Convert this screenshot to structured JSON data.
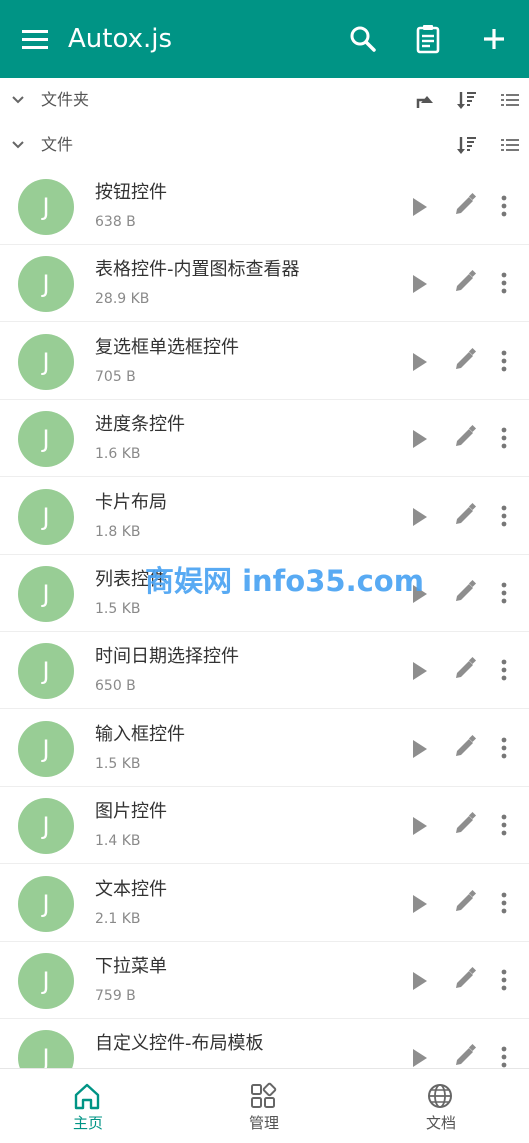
{
  "app": {
    "title": "Autox.js"
  },
  "sections": {
    "folders_label": "文件夹",
    "files_label": "文件"
  },
  "files": [
    {
      "name": "按钮控件",
      "size": "638 B"
    },
    {
      "name": "表格控件-内置图标查看器",
      "size": "28.9 KB"
    },
    {
      "name": "复选框单选框控件",
      "size": "705 B"
    },
    {
      "name": "进度条控件",
      "size": "1.6 KB"
    },
    {
      "name": "卡片布局",
      "size": "1.8 KB"
    },
    {
      "name": "列表控件",
      "size": "1.5 KB"
    },
    {
      "name": "时间日期选择控件",
      "size": "650 B"
    },
    {
      "name": "输入框控件",
      "size": "1.5 KB"
    },
    {
      "name": "图片控件",
      "size": "1.4 KB"
    },
    {
      "name": "文本控件",
      "size": "2.1 KB"
    },
    {
      "name": "下拉菜单",
      "size": "759 B"
    },
    {
      "name": "自定义控件-布局模板",
      "size": ""
    }
  ],
  "avatar_letter": "J",
  "watermark": "商娱网 info35.com",
  "bottom_nav": {
    "home": "主页",
    "manage": "管理",
    "docs": "文档"
  },
  "colors": {
    "primary": "#009485",
    "avatar": "#98cd95",
    "watermark": "#4aa3f3"
  }
}
